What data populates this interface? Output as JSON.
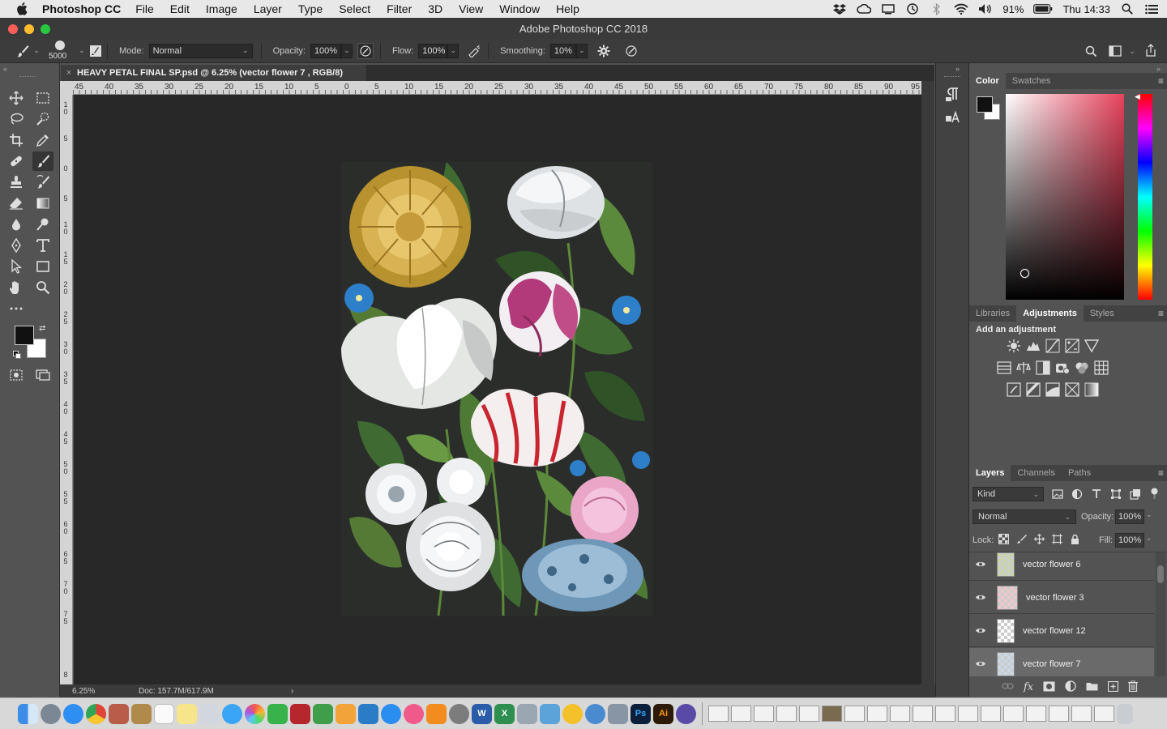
{
  "menubar": {
    "app_name": "Photoshop CC",
    "items": [
      "File",
      "Edit",
      "Image",
      "Layer",
      "Type",
      "Select",
      "Filter",
      "3D",
      "View",
      "Window",
      "Help"
    ],
    "battery": "91%",
    "clock": "Thu 14:33"
  },
  "window": {
    "title": "Adobe Photoshop CC 2018"
  },
  "options": {
    "brush_size": "5000",
    "mode_label": "Mode:",
    "mode_value": "Normal",
    "opacity_label": "Opacity:",
    "opacity_value": "100%",
    "flow_label": "Flow:",
    "flow_value": "100%",
    "smoothing_label": "Smoothing:",
    "smoothing_value": "10%"
  },
  "document": {
    "tab_title": "HEAVY PETAL FINAL SP.psd @ 6.25% (vector flower 7 , RGB/8)",
    "zoom": "6.25%",
    "doc_info": "Doc: 157.7M/617.9M"
  },
  "ruler_h": [
    "45",
    "40",
    "35",
    "30",
    "25",
    "20",
    "15",
    "10",
    "5",
    "0",
    "5",
    "10",
    "15",
    "20",
    "25",
    "30",
    "35",
    "40",
    "45",
    "50",
    "55",
    "60",
    "65",
    "70",
    "75",
    "80",
    "85",
    "90",
    "95"
  ],
  "ruler_v": [
    "1 0",
    "5",
    "0",
    "5",
    "1 0",
    "1 5",
    "2 0",
    "2 5",
    "3 0",
    "3 5",
    "4 0",
    "4 5",
    "5 0",
    "5 5",
    "6 0",
    "6 5",
    "7 0",
    "7 5",
    "8"
  ],
  "color_panel": {
    "tabs": [
      "Color",
      "Swatches"
    ],
    "colors": {
      "hue_base": "#e8425c",
      "fg": "#111111",
      "bg": "#ffffff"
    }
  },
  "adjust_panel": {
    "tabs": [
      "Libraries",
      "Adjustments",
      "Styles"
    ],
    "heading": "Add an adjustment"
  },
  "layers_panel": {
    "tabs": [
      "Layers",
      "Channels",
      "Paths"
    ],
    "kind": "Kind",
    "blend": "Normal",
    "opacity_label": "Opacity:",
    "opacity_value": "100%",
    "lock_label": "Lock:",
    "fill_label": "Fill:",
    "fill_value": "100%",
    "layers": [
      {
        "name": "vector flower 6"
      },
      {
        "name": "vector flower 3"
      },
      {
        "name": "vector flower 12"
      },
      {
        "name": "vector flower 7"
      }
    ]
  }
}
